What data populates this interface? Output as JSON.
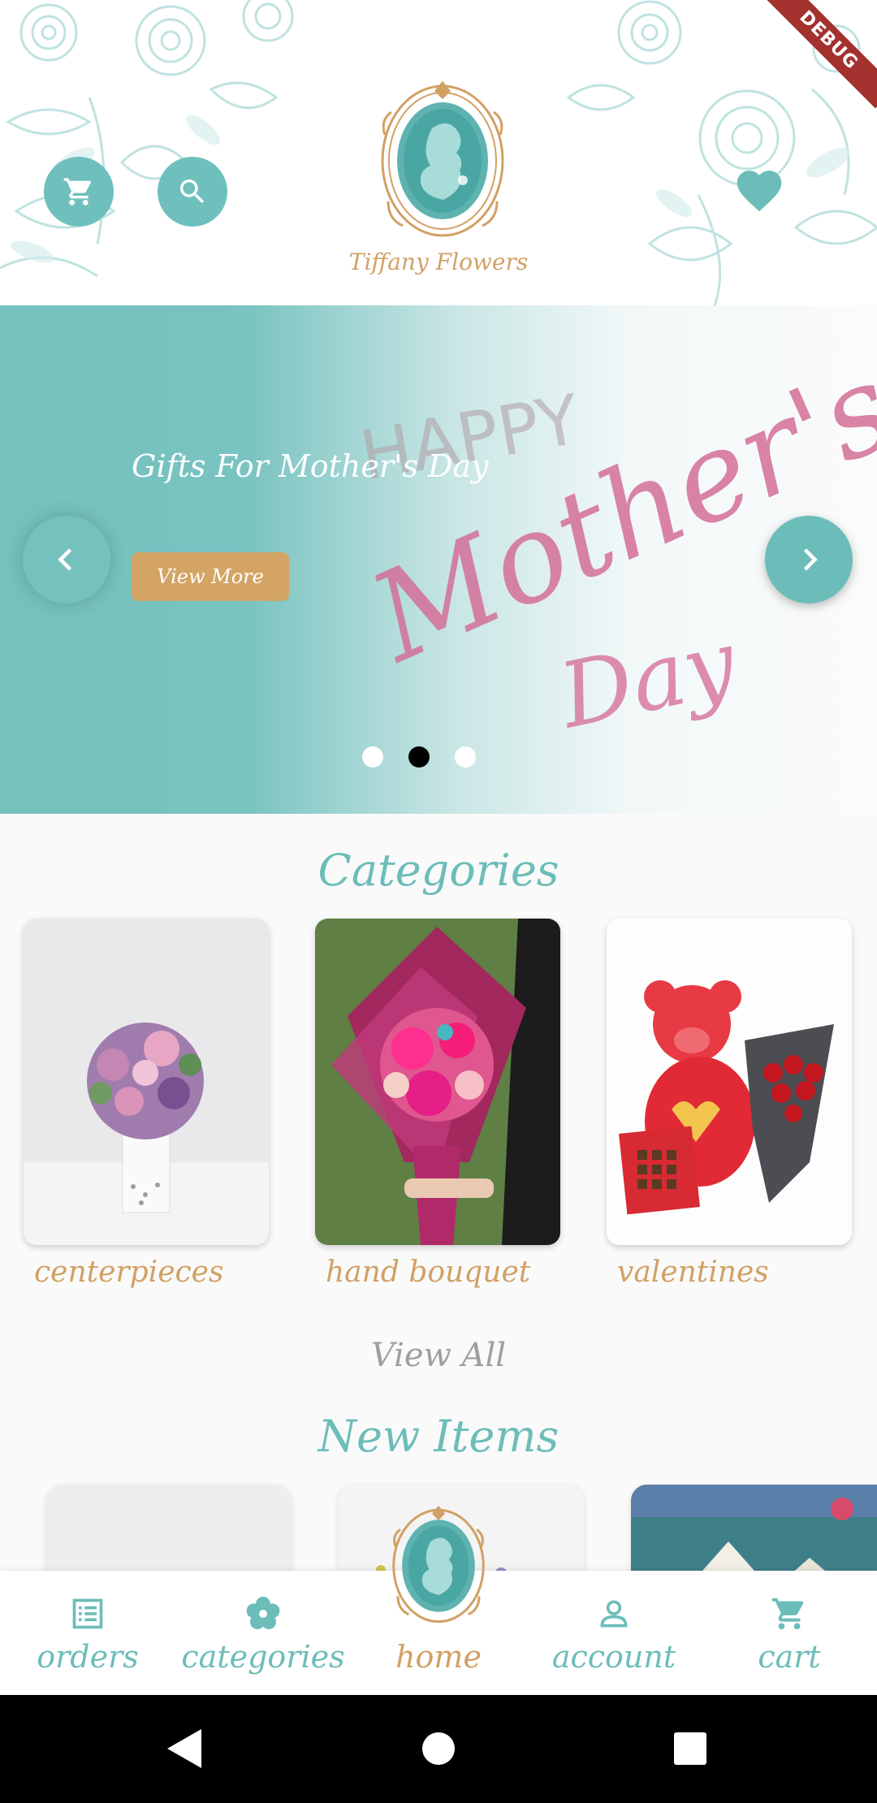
{
  "colors": {
    "teal": "#6cbdb9",
    "gold": "#d2a064",
    "debug_ribbon": "#a3312e",
    "background": "#fafafa"
  },
  "header": {
    "brand": "Tiffany Flowers",
    "debug_label": "DEBUG",
    "cart_icon": "cart-icon",
    "search_icon": "search-icon",
    "favorites_icon": "heart-icon"
  },
  "banner": {
    "title": "Gifts For Mother's Day",
    "button_label": "View More",
    "art_text": [
      "HAPPY",
      "Mother's",
      "Day"
    ],
    "slide_count": 3,
    "active_slide": 2
  },
  "categories": {
    "title": "Categories",
    "items": [
      {
        "label": "centerpieces"
      },
      {
        "label": "hand bouquet"
      },
      {
        "label": "valentines"
      }
    ],
    "view_all": "View All"
  },
  "new_items": {
    "title": "New Items"
  },
  "bottom_nav": {
    "items": [
      {
        "label": "orders",
        "icon": "list-icon"
      },
      {
        "label": "categories",
        "icon": "flower-icon"
      },
      {
        "label": "home",
        "icon": "logo-icon"
      },
      {
        "label": "account",
        "icon": "person-icon"
      },
      {
        "label": "cart",
        "icon": "cart-icon"
      }
    ],
    "active": "home"
  }
}
